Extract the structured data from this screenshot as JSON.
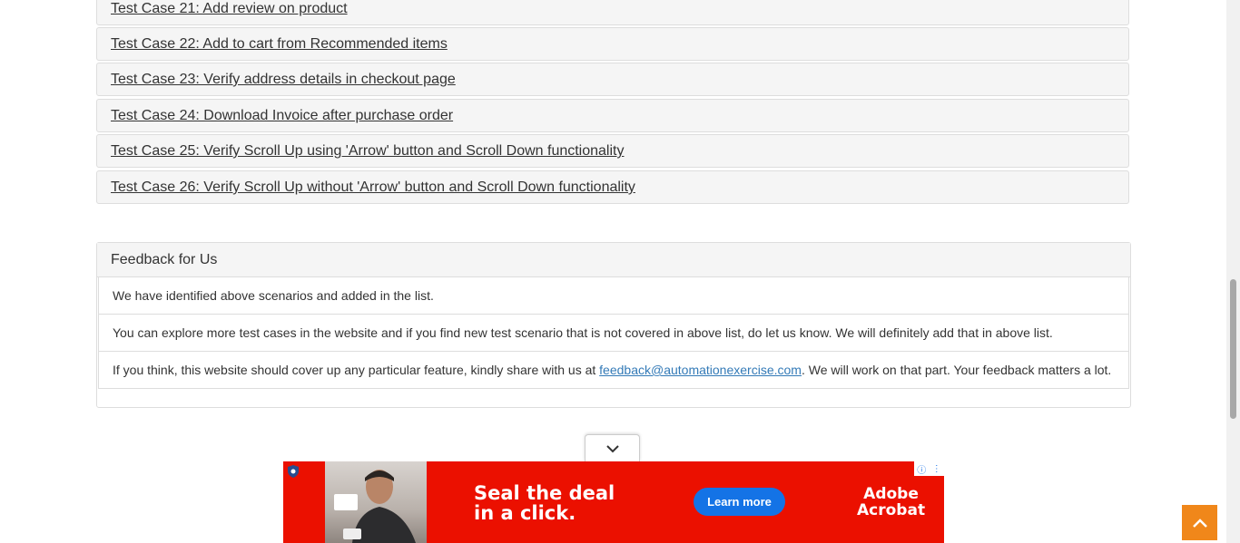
{
  "test_cases": [
    {
      "label": "Test Case 21: Add review on product"
    },
    {
      "label": "Test Case 22: Add to cart from Recommended items"
    },
    {
      "label": "Test Case 23: Verify address details in checkout page"
    },
    {
      "label": "Test Case 24: Download Invoice after purchase order"
    },
    {
      "label": "Test Case 25: Verify Scroll Up using 'Arrow' button and Scroll Down functionality"
    },
    {
      "label": "Test Case 26: Verify Scroll Up without 'Arrow' button and Scroll Down functionality"
    }
  ],
  "feedback": {
    "heading": "Feedback for Us",
    "row1": "We have identified above scenarios and added in the list.",
    "row2": "You can explore more test cases in the website and if you find new test scenario that is not covered in above list, do let us know. We will definitely add that in above list.",
    "row3_before": "If you think, this website should cover up any particular feature, kindly share with us at ",
    "row3_email": "feedback@automationexercise.com",
    "row3_after": ". We will work on that part. Your feedback matters a lot."
  },
  "ad": {
    "headline_line1": "Seal the deal",
    "headline_line2": "in a click.",
    "cta": "Learn more",
    "brand_line1": "Adobe",
    "brand_line2": "Acrobat",
    "bg_color": "#eb1000",
    "cta_color": "#1473e6"
  },
  "scroll_to_top": {
    "icon": "chevron-up-icon",
    "color": "#f0871a"
  }
}
